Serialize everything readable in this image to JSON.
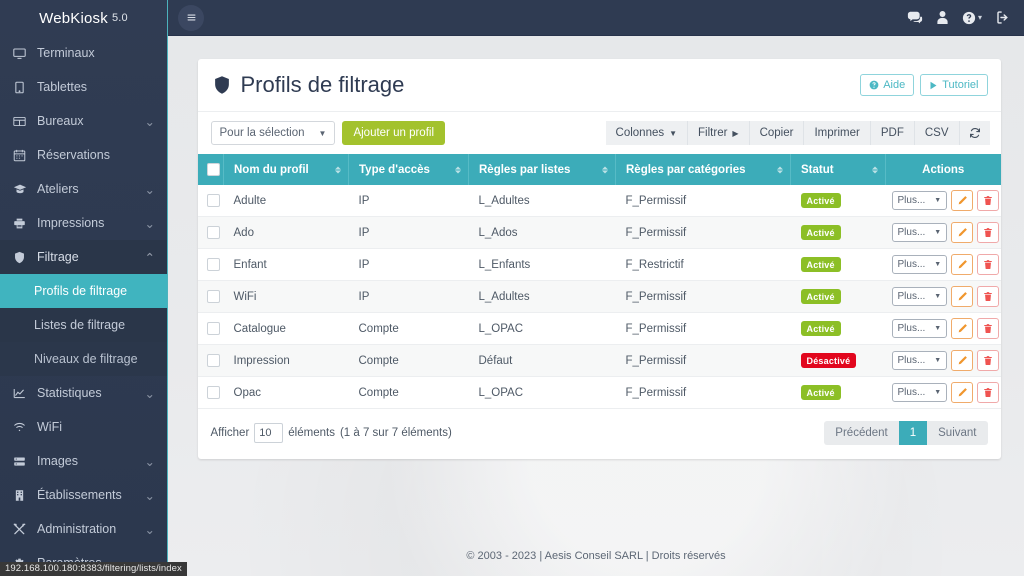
{
  "brand": {
    "name": "WebKiosk",
    "version": "5.0"
  },
  "topbar": {
    "menu_toggle": "☰",
    "icons": [
      {
        "name": "comments-icon"
      },
      {
        "name": "user-icon"
      },
      {
        "name": "help-icon",
        "caret": "▾"
      },
      {
        "name": "sign-out-icon"
      }
    ]
  },
  "sidebar": {
    "items": [
      {
        "label": "Terminaux",
        "icon": "desktop-icon",
        "caret": ""
      },
      {
        "label": "Tablettes",
        "icon": "tablet-icon",
        "caret": ""
      },
      {
        "label": "Bureaux",
        "icon": "table-grid-icon",
        "caret": "⌄"
      },
      {
        "label": "Réservations",
        "icon": "calendar-icon",
        "caret": ""
      },
      {
        "label": "Ateliers",
        "icon": "graduation-cap-icon",
        "caret": "⌄"
      },
      {
        "label": "Impressions",
        "icon": "printer-icon",
        "caret": "⌄"
      },
      {
        "label": "Filtrage",
        "icon": "shield-icon",
        "caret": "⌃",
        "open": true
      },
      {
        "label": "Statistiques",
        "icon": "chart-line-icon",
        "caret": "⌄"
      },
      {
        "label": "WiFi",
        "icon": "wifi-icon",
        "caret": ""
      },
      {
        "label": "Images",
        "icon": "server-icon",
        "caret": "⌄"
      },
      {
        "label": "Établissements",
        "icon": "building-icon",
        "caret": "⌄"
      },
      {
        "label": "Administration",
        "icon": "tools-icon",
        "caret": "⌄"
      },
      {
        "label": "Paramètres",
        "icon": "gear-icon",
        "caret": ""
      }
    ],
    "subitems": [
      {
        "label": "Profils de filtrage",
        "active": true
      },
      {
        "label": "Listes de filtrage",
        "active": false
      },
      {
        "label": "Niveaux de filtrage",
        "active": false
      }
    ]
  },
  "panel": {
    "title": "Profils de filtrage",
    "title_icon": "shield-icon",
    "help_button": "Aide",
    "tutorial_button": "Tutoriel"
  },
  "toolbar": {
    "selection_label": "Pour la sélection",
    "add_label": "Ajouter un profil",
    "dt_buttons": [
      {
        "label": "Colonnes",
        "caret": true
      },
      {
        "label": "Filtrer",
        "arrow": true
      },
      {
        "label": "Copier"
      },
      {
        "label": "Imprimer"
      },
      {
        "label": "PDF"
      },
      {
        "label": "CSV"
      }
    ],
    "refresh_icon": "refresh-icon"
  },
  "table": {
    "columns": [
      {
        "label": "Nom du profil",
        "sortable": true
      },
      {
        "label": "Type d'accès",
        "sortable": true
      },
      {
        "label": "Règles par listes",
        "sortable": true
      },
      {
        "label": "Règles par catégories",
        "sortable": true
      },
      {
        "label": "Statut",
        "sortable": true
      },
      {
        "label": "Actions",
        "sortable": false
      }
    ],
    "rows": [
      {
        "name": "Adulte",
        "type": "IP",
        "list_rules": "L_Adultes",
        "cat_rules": "F_Permissif",
        "status": "Activé",
        "status_on": true
      },
      {
        "name": "Ado",
        "type": "IP",
        "list_rules": "L_Ados",
        "cat_rules": "F_Permissif",
        "status": "Activé",
        "status_on": true
      },
      {
        "name": "Enfant",
        "type": "IP",
        "list_rules": "L_Enfants",
        "cat_rules": "F_Restrictif",
        "status": "Activé",
        "status_on": true
      },
      {
        "name": "WiFi",
        "type": "IP",
        "list_rules": "L_Adultes",
        "cat_rules": "F_Permissif",
        "status": "Activé",
        "status_on": true
      },
      {
        "name": "Catalogue",
        "type": "Compte",
        "list_rules": "L_OPAC",
        "cat_rules": "F_Permissif",
        "status": "Activé",
        "status_on": true
      },
      {
        "name": "Impression",
        "type": "Compte",
        "list_rules": "Défaut",
        "cat_rules": "F_Permissif",
        "status": "Désactivé",
        "status_on": false
      },
      {
        "name": "Opac",
        "type": "Compte",
        "list_rules": "L_OPAC",
        "cat_rules": "F_Permissif",
        "status": "Activé",
        "status_on": true
      }
    ],
    "row_actions": {
      "more_label": "Plus...",
      "edit_icon": "pencil-icon",
      "delete_icon": "trash-icon"
    }
  },
  "footer": {
    "show_label": "Afficher",
    "page_length": "10",
    "elements_label": "éléments",
    "info": "(1 à 7 sur 7 éléments)",
    "prev": "Précédent",
    "page": "1",
    "next": "Suivant"
  },
  "page_footer": {
    "copyright": "© 2003 - 2023 | Aesis Conseil SARL | Droits réservés"
  },
  "status_bar": {
    "url": "192.168.100.180:8383/filtering/lists/index"
  },
  "colors": {
    "sidebar_bg": "#2f3b52",
    "accent_teal": "#3cacb9",
    "active_teal": "#40b4bf",
    "green_button": "#a3c22d",
    "badge_on": "#8cbf26",
    "badge_off": "#e2071e",
    "edit_orange": "#f0962e",
    "delete_red": "#ef5350"
  }
}
